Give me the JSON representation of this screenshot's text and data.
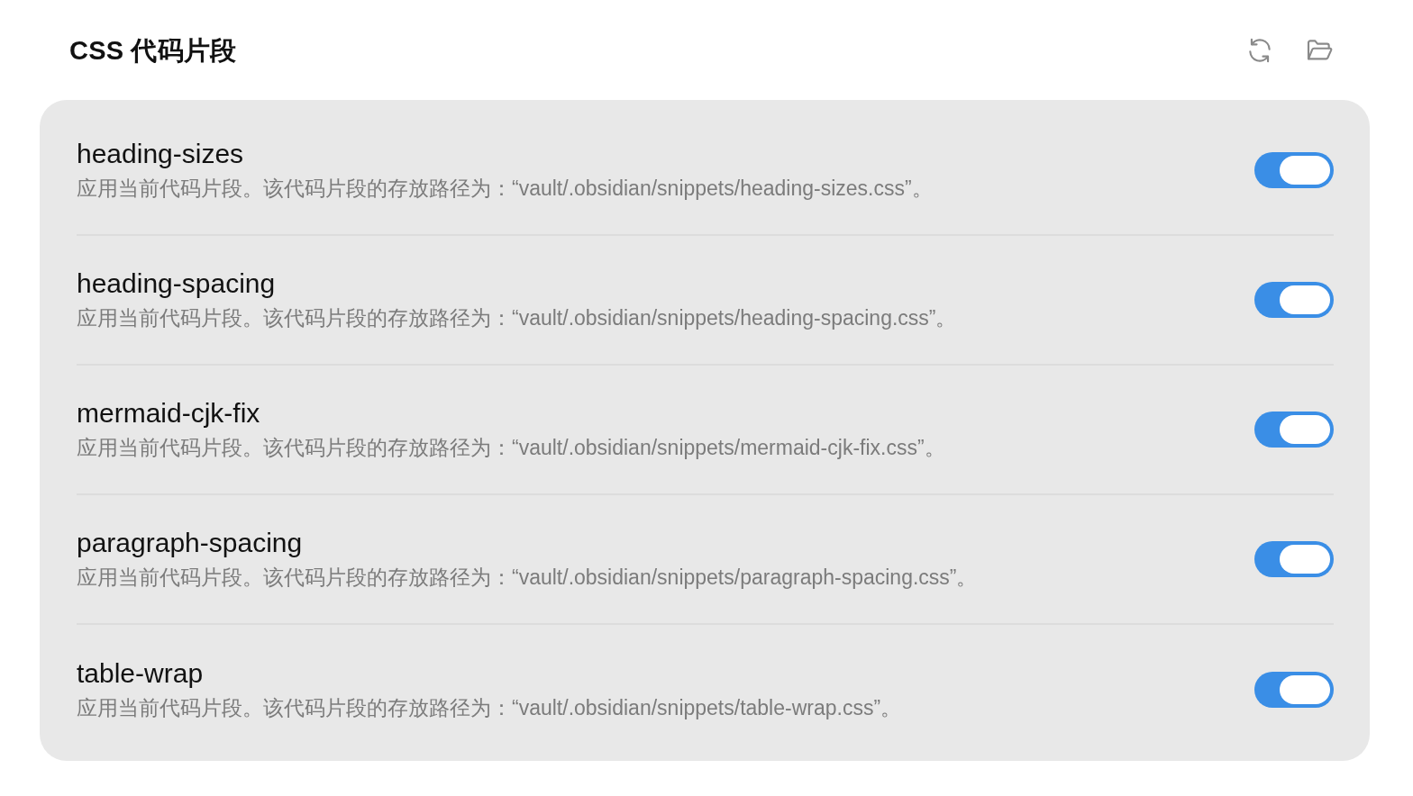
{
  "header": {
    "title": "CSS 代码片段"
  },
  "snippets": [
    {
      "name": "heading-sizes",
      "description": "应用当前代码片段。该代码片段的存放路径为：“vault/.obsidian/snippets/heading-sizes.css”。",
      "enabled": true
    },
    {
      "name": "heading-spacing",
      "description": "应用当前代码片段。该代码片段的存放路径为：“vault/.obsidian/snippets/heading-spacing.css”。",
      "enabled": true
    },
    {
      "name": "mermaid-cjk-fix",
      "description": "应用当前代码片段。该代码片段的存放路径为：“vault/.obsidian/snippets/mermaid-cjk-fix.css”。",
      "enabled": true
    },
    {
      "name": "paragraph-spacing",
      "description": "应用当前代码片段。该代码片段的存放路径为：“vault/.obsidian/snippets/paragraph-spacing.css”。",
      "enabled": true
    },
    {
      "name": "table-wrap",
      "description": "应用当前代码片段。该代码片段的存放路径为：“vault/.obsidian/snippets/table-wrap.css”。",
      "enabled": true
    }
  ]
}
